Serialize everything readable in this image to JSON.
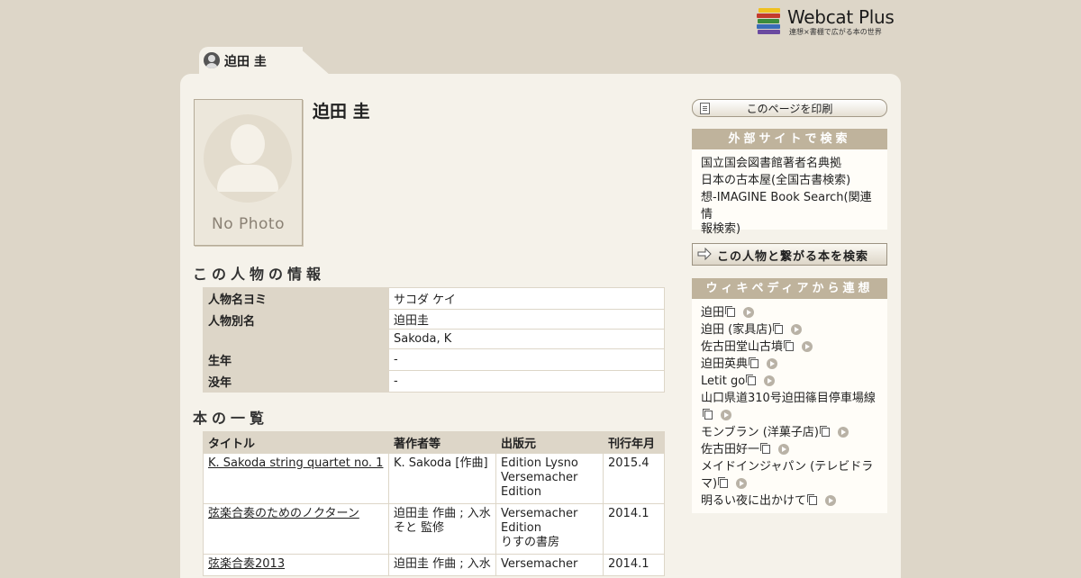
{
  "logo": {
    "title": "Webcat Plus",
    "subtitle": "連想×書棚で広がる本の世界",
    "colors": [
      "#f0c020",
      "#c43a2c",
      "#3c8c3c",
      "#3a6cb8",
      "#6a4aa0"
    ]
  },
  "tab": {
    "label": "迫田 圭",
    "icon": "person-icon"
  },
  "person": {
    "name": "迫田 圭",
    "photo_text": "No Photo"
  },
  "info_section": {
    "heading": "この人物の情報",
    "rows": {
      "reading": {
        "key": "人物名ヨミ",
        "value": "サコダ ケイ"
      },
      "aliases": {
        "key": "人物別名",
        "values": [
          "迫田圭",
          "Sakoda, K"
        ]
      },
      "birth": {
        "key": "生年",
        "value": "-"
      },
      "death": {
        "key": "没年",
        "value": "-"
      }
    }
  },
  "books_section": {
    "heading": "本の一覧",
    "columns": [
      "タイトル",
      "著作者等",
      "出版元",
      "刊行年月"
    ],
    "rows": [
      {
        "title": "K. Sakoda string quartet no. 1",
        "authors": [
          "K. Sakoda [作曲]"
        ],
        "publishers": [
          "Edition Lysno",
          "Versemacher",
          "Edition"
        ],
        "date": "2015.4"
      },
      {
        "title": "弦楽合奏のためのノクターン",
        "authors": [
          "迫田圭 作曲 ; 入水",
          "そと 監修"
        ],
        "publishers": [
          "Versemacher",
          "Edition",
          "りすの書房"
        ],
        "date": "2014.1"
      },
      {
        "title": "弦楽合奏2013",
        "authors": [
          "迫田圭 作曲 ; 入水"
        ],
        "publishers": [
          "Versemacher"
        ],
        "date": "2014.1"
      }
    ]
  },
  "sidebar": {
    "print_label": "このページを印刷",
    "external_heading": "外部サイトで検索",
    "external_links": [
      "国立国会図書館著者名典拠",
      "日本の古本屋(全国古書検索)",
      "想-IMAGINE Book Search(関連情",
      "報検索)"
    ],
    "search_books_label": "この人物と繋がる本を検索",
    "wiki_heading": "ウィキペディアから連想",
    "wiki_items": [
      {
        "lines": [
          "迫田"
        ]
      },
      {
        "lines": [
          "迫田 (家具店)"
        ]
      },
      {
        "lines": [
          "佐古田堂山古墳"
        ]
      },
      {
        "lines": [
          "迫田英典"
        ]
      },
      {
        "lines": [
          "Letit go"
        ]
      },
      {
        "lines": [
          "山口県道310号迫田篠目停車場線"
        ],
        "icons_on_new_line": true
      },
      {
        "lines": [
          "モンブラン (洋菓子店)"
        ]
      },
      {
        "lines": [
          "佐古田好一"
        ]
      },
      {
        "lines": [
          "メイドインジャパン (テレビドラ",
          "マ)"
        ]
      },
      {
        "lines": [
          "明るい夜に出かけて"
        ]
      }
    ]
  }
}
